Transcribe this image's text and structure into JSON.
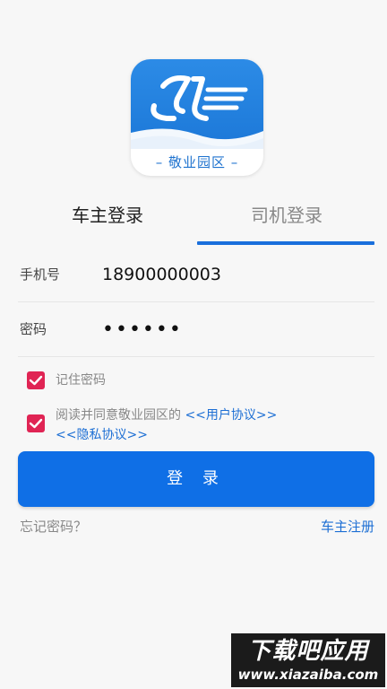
{
  "logo": {
    "text": "– 敬业园区 –",
    "colors": {
      "primary": "#1c78d8",
      "text": "#1f73cf"
    }
  },
  "tabs": [
    {
      "label": "车主登录",
      "active": false
    },
    {
      "label": "司机登录",
      "active": true
    }
  ],
  "form": {
    "phone_label": "手机号",
    "phone_value": "18900000003",
    "password_label": "密码",
    "password_value": "••••••"
  },
  "options": {
    "remember_label": "记住密码",
    "remember_checked": true,
    "agree_checked": true,
    "agree_text": "阅读并同意敬业园区的 ",
    "user_agreement": "<<用户协议>>",
    "privacy_agreement": "<<隐私协议>>"
  },
  "actions": {
    "login_label": "登 录",
    "forgot_label": "忘记密码？",
    "register_label": "车主注册"
  },
  "colors": {
    "accent": "#0f6fe6",
    "checkbox": "#e02454",
    "link": "#1d6fd4"
  },
  "watermark": {
    "title": "下载吧应用",
    "url": "www.xiazaiba.com"
  }
}
